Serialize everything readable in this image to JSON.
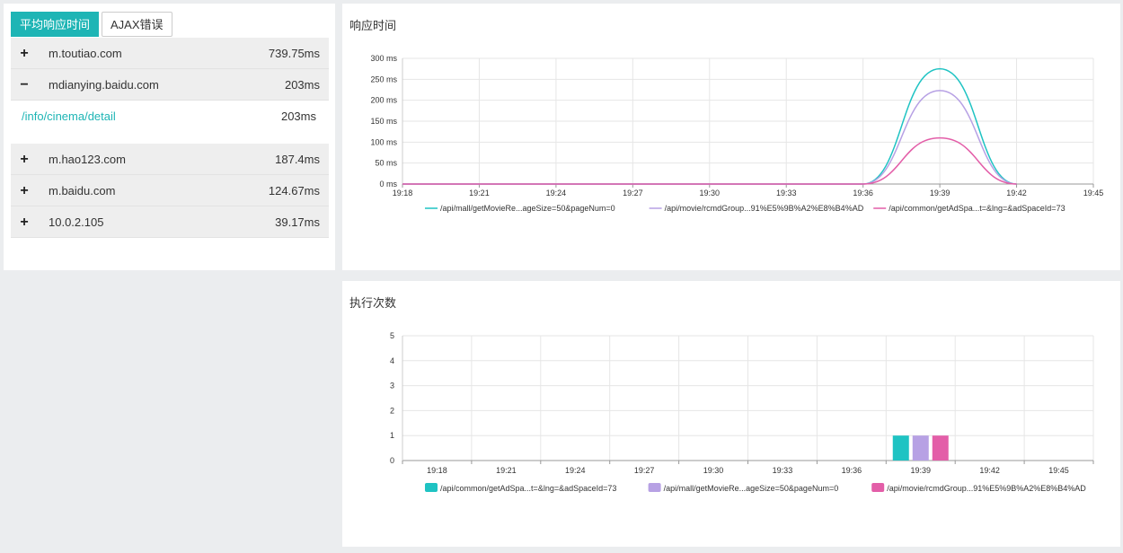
{
  "tabs": {
    "avg_response": "平均响应时间",
    "ajax_errors": "AJAX错误"
  },
  "hosts": [
    {
      "toggle": "+",
      "name": "m.toutiao.com",
      "time": "739.75ms"
    },
    {
      "toggle": "−",
      "name": "mdianying.baidu.com",
      "time": "203ms",
      "children": [
        {
          "path": "/info/cinema/detail",
          "time": "203ms"
        }
      ]
    },
    {
      "toggle": "+",
      "name": "m.hao123.com",
      "time": "187.4ms"
    },
    {
      "toggle": "+",
      "name": "m.baidu.com",
      "time": "124.67ms"
    },
    {
      "toggle": "+",
      "name": "10.0.2.105",
      "time": "39.17ms"
    }
  ],
  "colors": {
    "teal": "#1fc3c3",
    "purple": "#b7a1e4",
    "pink": "#e35ea8",
    "accent": "#1eb5b5"
  },
  "chart_data": [
    {
      "type": "line",
      "title": "响应时间",
      "x": [
        "19:18",
        "19:21",
        "19:24",
        "19:27",
        "19:30",
        "19:33",
        "19:36",
        "19:39",
        "19:42",
        "19:45"
      ],
      "ylim": [
        0,
        300
      ],
      "yticks": [
        "0 ms",
        "50 ms",
        "100 ms",
        "150 ms",
        "200 ms",
        "250 ms",
        "300 ms"
      ],
      "series": [
        {
          "name": "/api/mall/getMovieRe...ageSize=50&pageNum=0",
          "color": "#1fc3c3",
          "values": [
            0,
            0,
            0,
            0,
            0,
            0,
            0,
            275,
            0,
            null
          ]
        },
        {
          "name": "/api/movie/rcmdGroup...91%E5%9B%A2%E8%B4%AD",
          "color": "#b7a1e4",
          "values": [
            0,
            0,
            0,
            0,
            0,
            0,
            0,
            223,
            0,
            null
          ]
        },
        {
          "name": "/api/common/getAdSpa...t=&lng=&adSpaceId=73",
          "color": "#e35ea8",
          "values": [
            0,
            0,
            0,
            0,
            0,
            0,
            0,
            110,
            0,
            null
          ]
        }
      ],
      "grid": true,
      "legend": "bottom"
    },
    {
      "type": "bar",
      "title": "执行次数",
      "categories": [
        "19:18",
        "19:21",
        "19:24",
        "19:27",
        "19:30",
        "19:33",
        "19:36",
        "19:39",
        "19:42",
        "19:45"
      ],
      "ylim": [
        0,
        5
      ],
      "yticks": [
        "0",
        "1",
        "2",
        "3",
        "4",
        "5"
      ],
      "series": [
        {
          "name": "/api/common/getAdSpa...t=&lng=&adSpaceId=73",
          "color": "#1fc3c3",
          "values": [
            0,
            0,
            0,
            0,
            0,
            0,
            0,
            1,
            0,
            0
          ]
        },
        {
          "name": "/api/mall/getMovieRe...ageSize=50&pageNum=0",
          "color": "#b7a1e4",
          "values": [
            0,
            0,
            0,
            0,
            0,
            0,
            0,
            1,
            0,
            0
          ]
        },
        {
          "name": "/api/movie/rcmdGroup...91%E5%9B%A2%E8%B4%AD",
          "color": "#e35ea8",
          "values": [
            0,
            0,
            0,
            0,
            0,
            0,
            0,
            1,
            0,
            0
          ]
        }
      ],
      "grid": true,
      "legend": "bottom"
    }
  ]
}
